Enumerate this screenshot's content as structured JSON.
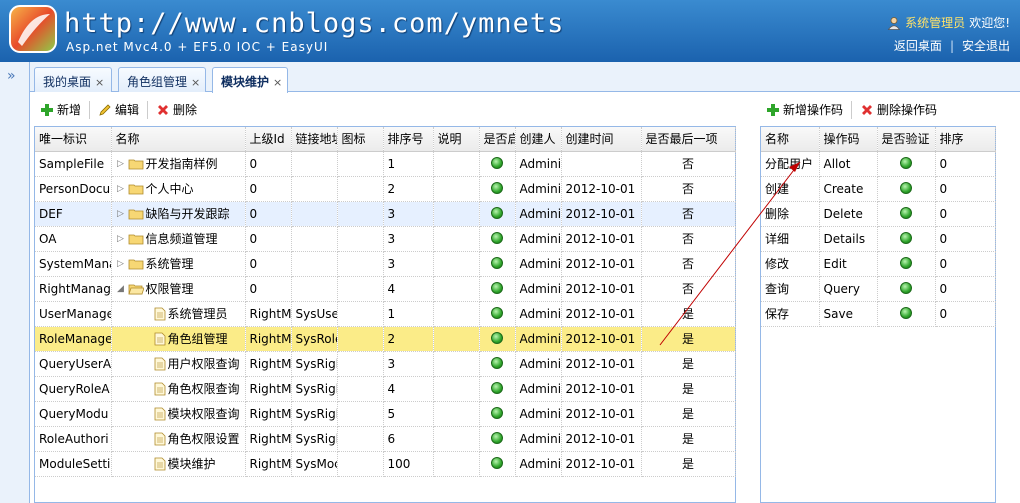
{
  "header": {
    "url": "http://www.cnblogs.com/ymnets",
    "tagline": "Asp.net Mvc4.0 + EF5.0 IOC + EasyUI",
    "user_name": "系统管理员",
    "welcome": "欢迎您!",
    "back_desktop": "返回桌面",
    "separator": "|",
    "logout": "安全退出"
  },
  "sidebar": {
    "expand_icon": "»"
  },
  "tabs": [
    {
      "label": "我的桌面",
      "close": "×"
    },
    {
      "label": "角色组管理",
      "close": "×"
    },
    {
      "label": "模块维护",
      "close": "×"
    }
  ],
  "left_toolbar": {
    "add": "新增",
    "edit": "编辑",
    "delete": "删除"
  },
  "right_toolbar": {
    "add_op": "新增操作码",
    "delete_op": "删除操作码"
  },
  "left_grid": {
    "columns": [
      "唯一标识",
      "名称",
      "上级Id",
      "链接地址",
      "图标",
      "排序号",
      "说明",
      "是否启",
      "创建人",
      "创建时间",
      "是否最后一项"
    ],
    "rows": [
      {
        "id": "SampleFile",
        "name": "开发指南样例",
        "parent": "0",
        "url": "",
        "sort": "1",
        "creator": "Adminis",
        "time": "",
        "last": "否",
        "node": "folder",
        "level": 0,
        "arrow": "▷"
      },
      {
        "id": "PersonDocu",
        "name": "个人中心",
        "parent": "0",
        "url": "",
        "sort": "2",
        "creator": "Adminis",
        "time": "2012-10-01",
        "last": "否",
        "node": "folder",
        "level": 0,
        "arrow": "▷"
      },
      {
        "id": "DEF",
        "name": "缺陷与开发跟踪",
        "parent": "0",
        "url": "",
        "sort": "3",
        "creator": "Adminis",
        "time": "2012-10-01",
        "last": "否",
        "node": "folder",
        "level": 0,
        "arrow": "▷"
      },
      {
        "id": "OA",
        "name": "信息频道管理",
        "parent": "0",
        "url": "",
        "sort": "3",
        "creator": "Adminis",
        "time": "2012-10-01",
        "last": "否",
        "node": "folder",
        "level": 0,
        "arrow": "▷"
      },
      {
        "id": "SystemMana",
        "name": "系统管理",
        "parent": "0",
        "url": "",
        "sort": "3",
        "creator": "Adminis",
        "time": "2012-10-01",
        "last": "否",
        "node": "folder",
        "level": 0,
        "arrow": "▷"
      },
      {
        "id": "RightManag",
        "name": "权限管理",
        "parent": "0",
        "url": "",
        "sort": "4",
        "creator": "Adminis",
        "time": "2012-10-01",
        "last": "否",
        "node": "folder-open",
        "level": 0,
        "arrow": "◢"
      },
      {
        "id": "UserManage",
        "name": "系统管理员",
        "parent": "RightM",
        "url": "SysUse",
        "sort": "1",
        "creator": "Adminis",
        "time": "2012-10-01",
        "last": "是",
        "node": "doc",
        "level": 1,
        "arrow": ""
      },
      {
        "id": "RoleManage",
        "name": "角色组管理",
        "parent": "RightM",
        "url": "SysRole",
        "sort": "2",
        "creator": "Adminis",
        "time": "2012-10-01",
        "last": "是",
        "node": "doc",
        "level": 1,
        "arrow": ""
      },
      {
        "id": "QueryUserA",
        "name": "用户权限查询",
        "parent": "RightM",
        "url": "SysRigh",
        "sort": "3",
        "creator": "Adminis",
        "time": "2012-10-01",
        "last": "是",
        "node": "doc",
        "level": 1,
        "arrow": ""
      },
      {
        "id": "QueryRoleA",
        "name": "角色权限查询",
        "parent": "RightM",
        "url": "SysRigh",
        "sort": "4",
        "creator": "Adminis",
        "time": "2012-10-01",
        "last": "是",
        "node": "doc",
        "level": 1,
        "arrow": ""
      },
      {
        "id": "QueryModu",
        "name": "模块权限查询",
        "parent": "RightM",
        "url": "SysRigh",
        "sort": "5",
        "creator": "Adminis",
        "time": "2012-10-01",
        "last": "是",
        "node": "doc",
        "level": 1,
        "arrow": ""
      },
      {
        "id": "RoleAuthori",
        "name": "角色权限设置",
        "parent": "RightM",
        "url": "SysRigh",
        "sort": "6",
        "creator": "Adminis",
        "time": "2012-10-01",
        "last": "是",
        "node": "doc",
        "level": 1,
        "arrow": ""
      },
      {
        "id": "ModuleSetti",
        "name": "模块维护",
        "parent": "RightM",
        "url": "SysMoc",
        "sort": "100",
        "creator": "Adminis",
        "time": "2012-10-01",
        "last": "是",
        "node": "doc",
        "level": 1,
        "arrow": ""
      }
    ]
  },
  "right_grid": {
    "columns": [
      "名称",
      "操作码",
      "是否验证",
      "排序"
    ],
    "rows": [
      {
        "name": "分配用户",
        "code": "Allot",
        "sort": "0"
      },
      {
        "name": "创建",
        "code": "Create",
        "sort": "0"
      },
      {
        "name": "删除",
        "code": "Delete",
        "sort": "0"
      },
      {
        "name": "详细",
        "code": "Details",
        "sort": "0"
      },
      {
        "name": "修改",
        "code": "Edit",
        "sort": "0"
      },
      {
        "name": "查询",
        "code": "Query",
        "sort": "0"
      },
      {
        "name": "保存",
        "code": "Save",
        "sort": "0"
      }
    ]
  },
  "colors": {
    "header_top": "#3a8bd0",
    "header_bottom": "#1b62ae",
    "selected_row": "#fbec88",
    "hover_row": "#e6f0ff",
    "border": "#95b8e7",
    "annotation_line": "#c00000"
  }
}
